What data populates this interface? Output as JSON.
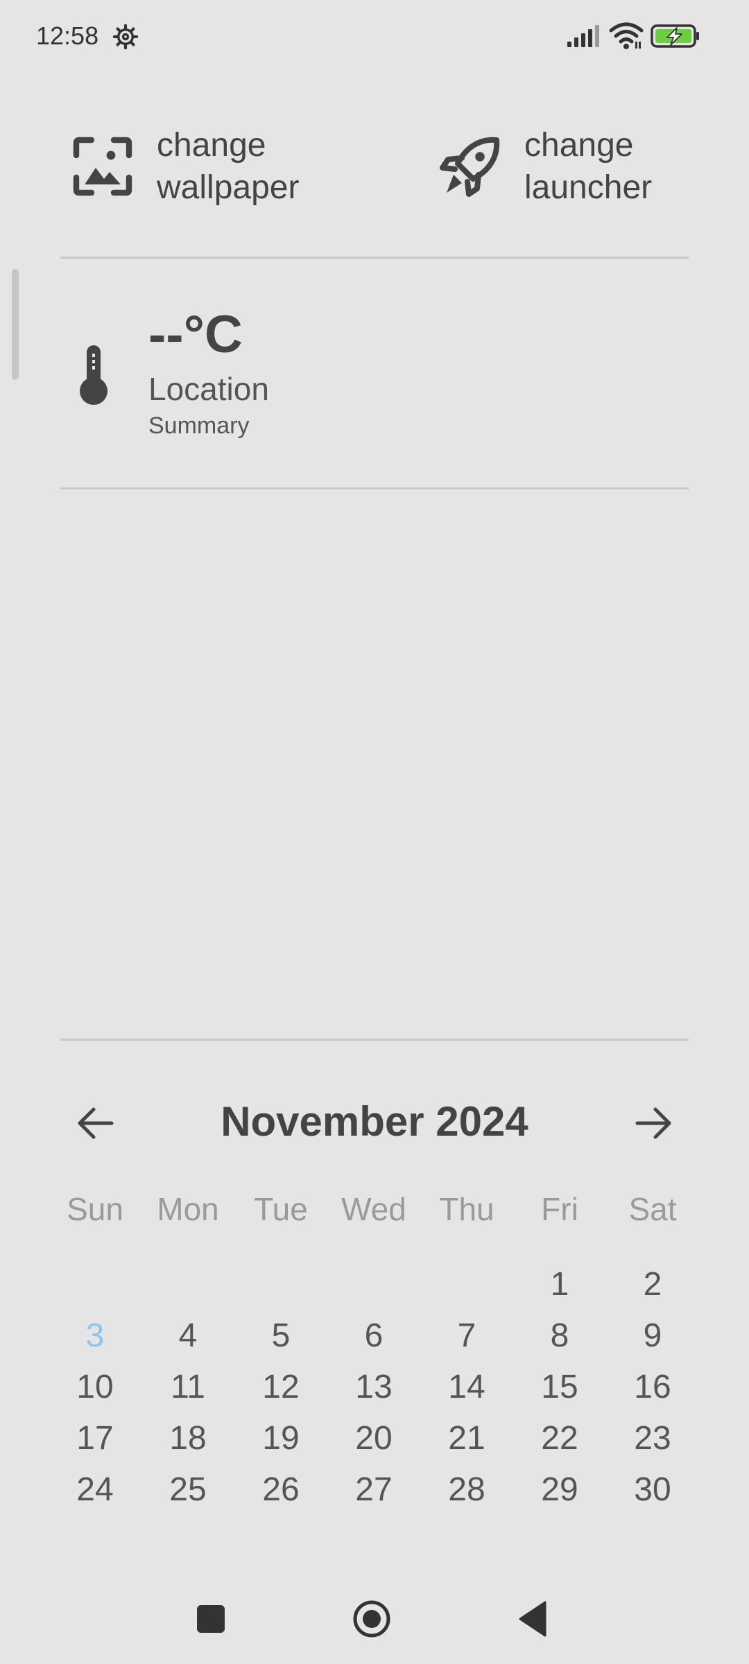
{
  "status_bar": {
    "time": "12:58",
    "icons": [
      "settings-icon",
      "signal-icon",
      "wifi-icon",
      "battery-charging-icon"
    ],
    "battery_color": "#6ccf3e"
  },
  "shortcuts": {
    "wallpaper": {
      "label": "change wallpaper",
      "icon": "wallpaper-icon"
    },
    "launcher": {
      "label": "change launcher",
      "icon": "rocket-icon"
    }
  },
  "weather": {
    "temperature": "--°C",
    "location": "Location",
    "summary": "Summary",
    "icon": "thermometer-icon"
  },
  "calendar": {
    "title": "November 2024",
    "weekdays": [
      "Sun",
      "Mon",
      "Tue",
      "Wed",
      "Thu",
      "Fri",
      "Sat"
    ],
    "leading_blanks": 5,
    "days": [
      "1",
      "2",
      "3",
      "4",
      "5",
      "6",
      "7",
      "8",
      "9",
      "10",
      "11",
      "12",
      "13",
      "14",
      "15",
      "16",
      "17",
      "18",
      "19",
      "20",
      "21",
      "22",
      "23",
      "24",
      "25",
      "26",
      "27",
      "28",
      "29",
      "30"
    ],
    "today": "3",
    "today_color": "#8fc4ee"
  },
  "nav_bar": {
    "icons": [
      "recents-icon",
      "home-icon",
      "back-icon"
    ]
  }
}
